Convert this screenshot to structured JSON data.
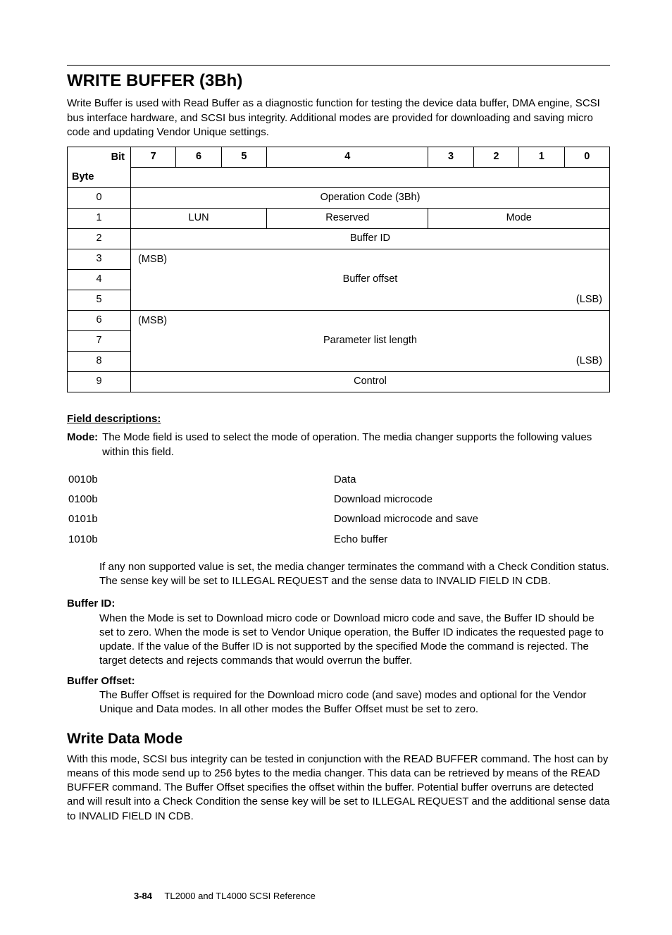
{
  "title": "WRITE BUFFER (3Bh)",
  "intro": "Write Buffer is used with Read Buffer as a diagnostic function for testing the device data buffer, DMA engine, SCSI bus interface hardware, and SCSI bus integrity. Additional modes are provided for downloading and saving micro code and updating Vendor Unique settings.",
  "table": {
    "bit_label": "Bit",
    "byte_label": "Byte",
    "bits": [
      "7",
      "6",
      "5",
      "4",
      "3",
      "2",
      "1",
      "0"
    ],
    "rows": {
      "b0": "0",
      "b1": "1",
      "b2": "2",
      "b3": "3",
      "b4": "4",
      "b5": "5",
      "b6": "6",
      "b7": "7",
      "b8": "8",
      "b9": "9"
    },
    "cells": {
      "opcode": "Operation Code (3Bh)",
      "lun": "LUN",
      "reserved": "Reserved",
      "mode": "Mode",
      "buffer_id": "Buffer ID",
      "msb1": "(MSB)",
      "buffer_offset": "Buffer offset",
      "lsb1": "(LSB)",
      "msb2": "(MSB)",
      "param_len": "Parameter list length",
      "lsb2": "(LSB)",
      "control": "Control"
    }
  },
  "fd_heading": "Field descriptions:",
  "mode_def": {
    "term": "Mode:",
    "text": "The Mode field is used to select the mode of operation. The media changer supports the following values within this field."
  },
  "mode_values": [
    {
      "code": "0010b",
      "desc": "Data"
    },
    {
      "code": "0100b",
      "desc": "Download microcode"
    },
    {
      "code": "0101b",
      "desc": "Download microcode and save"
    },
    {
      "code": "1010b",
      "desc": "Echo buffer"
    }
  ],
  "mode_followup": "If any non supported value is set, the media changer terminates the command with a Check Condition status. The sense key will be set to ILLEGAL REQUEST and the sense data to INVALID FIELD IN CDB.",
  "buffer_id_def": {
    "term": "Buffer ID:",
    "text": "When the Mode is set to Download micro code or Download micro code and save, the Buffer ID should be set to zero. When the mode is set to Vendor Unique operation, the Buffer ID indicates the requested page to update. If the value of the Buffer ID is not supported by the specified Mode the command is rejected. The target detects and rejects commands that would overrun the buffer."
  },
  "buffer_offset_def": {
    "term": "Buffer Offset:",
    "text": "The Buffer Offset is required for the Download micro code (and save) modes and optional for the Vendor Unique and Data modes. In all other modes the Buffer Offset must be set to zero."
  },
  "subhead": "Write Data Mode",
  "subtext": "With this mode, SCSI bus integrity can be tested in conjunction with the READ BUFFER command. The host can by means of this mode send up to 256 bytes to the media changer. This data can be retrieved by means of the READ BUFFER command. The Buffer Offset specifies the offset within the buffer. Potential buffer overruns are detected and will result into a Check Condition the sense key will be set to ILLEGAL REQUEST and the additional sense data to INVALID FIELD IN CDB.",
  "footer": {
    "page": "3-84",
    "doc": "TL2000 and TL4000 SCSI Reference"
  }
}
